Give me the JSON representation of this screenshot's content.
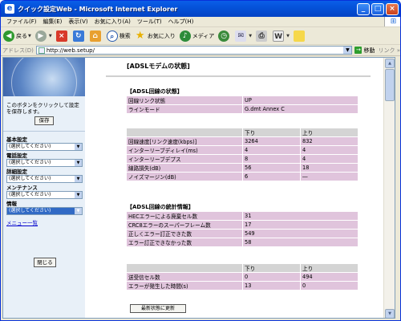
{
  "window": {
    "title": "クイック設定Web - Microsoft Internet Explorer",
    "controls": [
      "_",
      "□",
      "×"
    ]
  },
  "menubar": {
    "items": [
      "ファイル(F)",
      "編集(E)",
      "表示(V)",
      "お気に入り(A)",
      "ツール(T)",
      "ヘルプ(H)"
    ]
  },
  "toolbar": {
    "back_label": "戻る",
    "search_label": "検索",
    "favorites_label": "お気に入り",
    "media_label": "メディア"
  },
  "address": {
    "label": "アドレス(D)",
    "url": "http://web.setup/",
    "go_label": "移動",
    "links_label": "リンク »"
  },
  "sidebar": {
    "save_message": "このボタンをクリックして設定を保存します。",
    "save_button": "保存",
    "groups": [
      {
        "label": "基本設定",
        "value": "(選択してください)"
      },
      {
        "label": "電話設定",
        "value": "(選択してください)"
      },
      {
        "label": "詳細設定",
        "value": "(選択してください)"
      },
      {
        "label": "メンテナンス",
        "value": "(選択してください)"
      },
      {
        "label": "情報",
        "value": "(選択してください)"
      }
    ],
    "menu_list": "メニュー一覧",
    "close_button": "閉じる"
  },
  "main": {
    "page_title": "[ADSLモデムの状態]",
    "line_status": {
      "heading": "【ADSL回線の状態】",
      "rows": [
        {
          "label": "回線リンク状態",
          "value": "UP"
        },
        {
          "label": "ラインモード",
          "value": "G.dmt Annex C"
        }
      ]
    },
    "line_detail": {
      "headers": [
        "",
        "下り",
        "上り"
      ],
      "rows": [
        {
          "label": "回線速度[リンク速度(kbps)]",
          "down": "3264",
          "up": "832"
        },
        {
          "label": "インターリーブディレイ(ms)",
          "down": "4",
          "up": "4"
        },
        {
          "label": "インターリーブデプス",
          "down": "8",
          "up": "4"
        },
        {
          "label": "線路損失(dB)",
          "down": "56",
          "up": "18"
        },
        {
          "label": "ノイズマージン(dB)",
          "down": "6",
          "up": "―"
        }
      ]
    },
    "stats": {
      "heading": "【ADSL回線の統計情報】",
      "rows": [
        {
          "label": "HECエラーによる廃棄セル数",
          "value": "31"
        },
        {
          "label": "CRC8エラーのスーパーフレーム数",
          "value": "17"
        },
        {
          "label": "正しくエラー訂正できた数",
          "value": "549"
        },
        {
          "label": "エラー訂正できなかった数",
          "value": "58"
        }
      ]
    },
    "cells": {
      "headers": [
        "",
        "下り",
        "上り"
      ],
      "rows": [
        {
          "label": "送受信セル数",
          "down": "0",
          "up": "494"
        },
        {
          "label": "エラーが発生した時間(s)",
          "down": "13",
          "up": "0"
        }
      ]
    },
    "refresh_button": "最新状態に更新"
  }
}
